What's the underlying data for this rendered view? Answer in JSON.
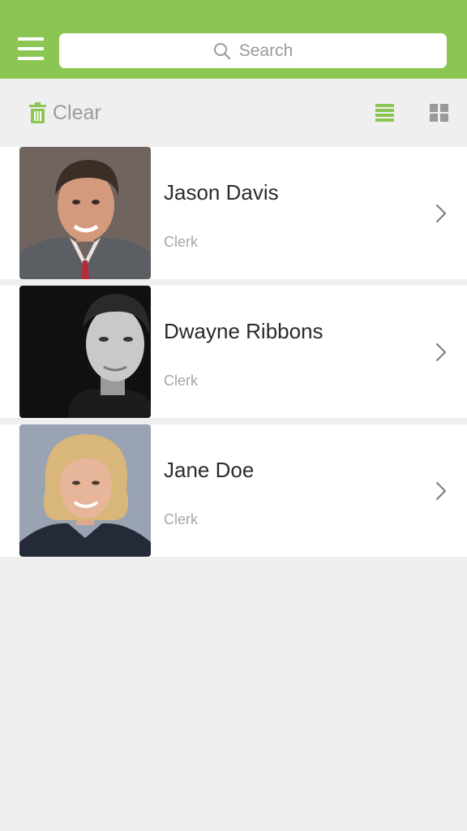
{
  "search": {
    "placeholder": "Search",
    "icon": "search-icon"
  },
  "toolbar": {
    "clear_label": "Clear"
  },
  "colors": {
    "accent": "#8bc652",
    "background": "#efefef"
  },
  "people": [
    {
      "name": "Jason Davis",
      "role": "Clerk"
    },
    {
      "name": "Dwayne Ribbons",
      "role": "Clerk"
    },
    {
      "name": "Jane Doe",
      "role": "Clerk"
    }
  ]
}
